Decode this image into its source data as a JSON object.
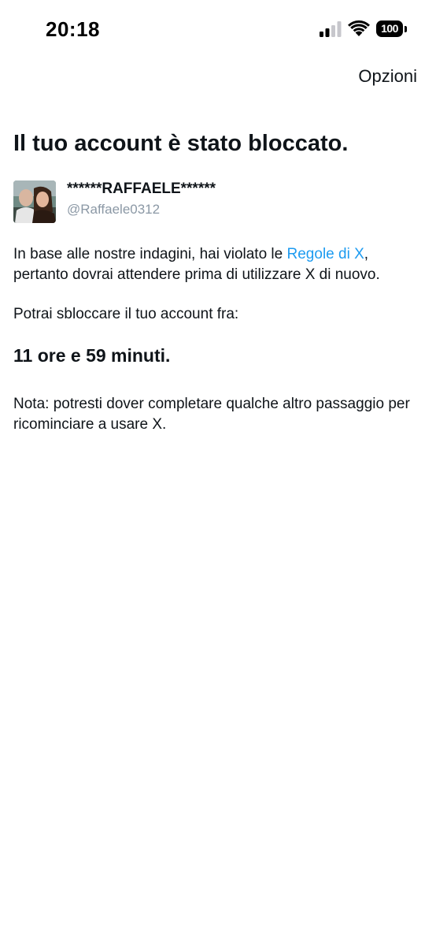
{
  "status_bar": {
    "time": "20:18",
    "battery": "100",
    "icons": [
      "signal-icon",
      "wifi-icon",
      "battery-icon"
    ]
  },
  "header": {
    "options_label": "Opzioni"
  },
  "title": "Il tuo account è stato bloccato.",
  "profile": {
    "display_name": "******RAFFAELE******",
    "handle": "@Raffaele0312"
  },
  "body": {
    "violation_text_before": "In base alle nostre indagini, hai violato le ",
    "rules_link": "Regole di X",
    "violation_text_after": ", pertanto dovrai attendere prima di utilizzare X di nuovo.",
    "unlock_intro": "Potrai sbloccare il tuo account fra:",
    "countdown": "11 ore e 59 minuti.",
    "note": "Nota: potresti dover completare qualche altro passaggio per ricominciare a usare X."
  },
  "colors": {
    "link": "#1d9bf0",
    "text": "#0f1419",
    "secondary_text": "#8b98a5"
  }
}
